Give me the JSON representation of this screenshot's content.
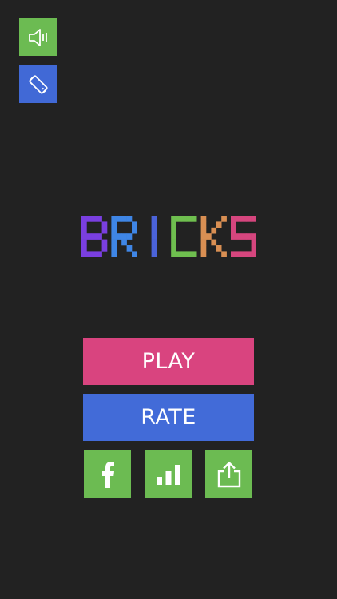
{
  "game": {
    "title_letters": [
      {
        "char": "B",
        "color": "#7a3fe0"
      },
      {
        "char": "R",
        "color": "#3f86e6"
      },
      {
        "char": "I",
        "color": "#4b63d9"
      },
      {
        "char": "C",
        "color": "#6fbf4f"
      },
      {
        "char": "K",
        "color": "#d98f53"
      },
      {
        "char": "S",
        "color": "#d6467e"
      }
    ]
  },
  "controls": {
    "sound": {
      "icon": "speaker-icon",
      "color": "#6cbb52"
    },
    "rotate": {
      "icon": "rotate-phone-icon",
      "color": "#4169d6"
    }
  },
  "menu": {
    "play_label": "PLAY",
    "play_color": "#d9447f",
    "rate_label": "RATE",
    "rate_color": "#426bd8"
  },
  "social": {
    "color": "#6cbb52",
    "buttons": [
      {
        "icon": "facebook-icon"
      },
      {
        "icon": "leaderboard-icon"
      },
      {
        "icon": "share-icon"
      }
    ]
  }
}
